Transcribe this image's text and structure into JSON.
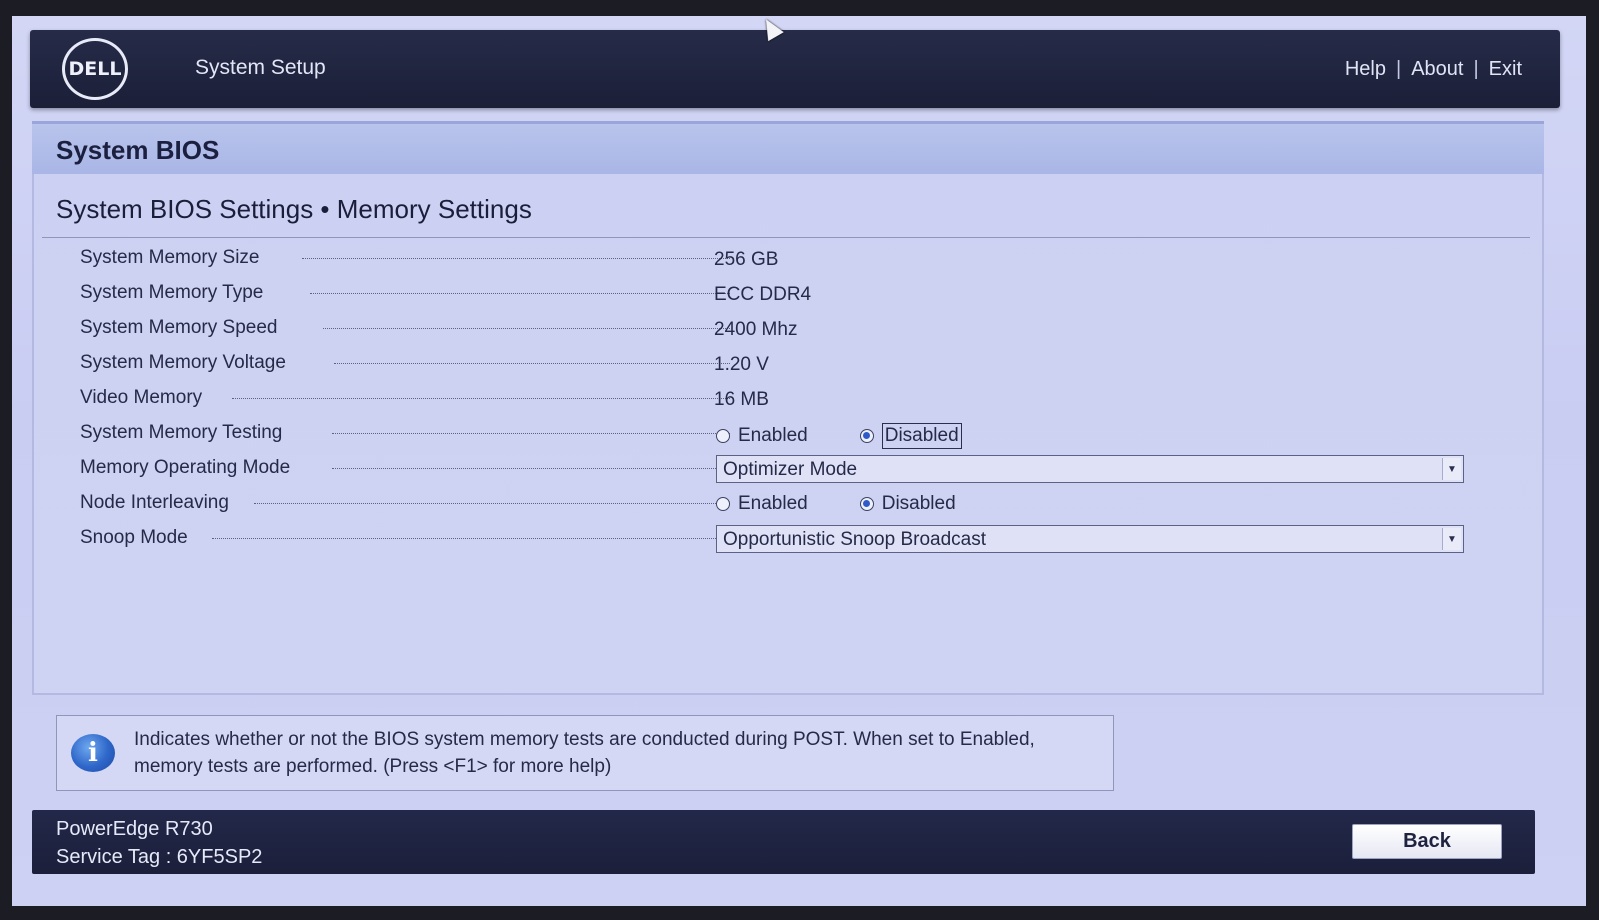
{
  "header": {
    "logo_text": "DELL",
    "title": "System Setup",
    "nav": [
      "Help",
      "About",
      "Exit"
    ]
  },
  "panel": {
    "title": "System BIOS",
    "section_title": "System BIOS Settings • Memory Settings"
  },
  "settings": {
    "memory_size": {
      "label": "System Memory Size",
      "value": "256 GB"
    },
    "memory_type": {
      "label": "System Memory Type",
      "value": "ECC DDR4"
    },
    "memory_speed": {
      "label": "System Memory Speed",
      "value": "2400 Mhz"
    },
    "memory_voltage": {
      "label": "System Memory Voltage",
      "value": "1.20 V"
    },
    "video_memory": {
      "label": "Video Memory",
      "value": "16 MB"
    },
    "memory_testing": {
      "label": "System Memory Testing",
      "option_enabled": "Enabled",
      "option_disabled": "Disabled",
      "selected": "Disabled"
    },
    "operating_mode": {
      "label": "Memory Operating Mode",
      "value": "Optimizer Mode"
    },
    "node_interleaving": {
      "label": "Node Interleaving",
      "option_enabled": "Enabled",
      "option_disabled": "Disabled",
      "selected": "Disabled"
    },
    "snoop_mode": {
      "label": "Snoop Mode",
      "value": "Opportunistic Snoop Broadcast"
    }
  },
  "help": {
    "icon": "info-icon",
    "text": "Indicates whether or not the BIOS system memory tests are conducted during POST. When set to Enabled, memory tests are performed. (Press <F1> for more help)"
  },
  "footer": {
    "model": "PowerEdge R730",
    "service_tag": "Service Tag : 6YF5SP2",
    "back_label": "Back"
  },
  "colors": {
    "header_bg": "#1b1f38",
    "panel_bg": "#ccd0f2",
    "title_bar": "#a9b6e6",
    "radio_selected": "#2f5bc9"
  }
}
